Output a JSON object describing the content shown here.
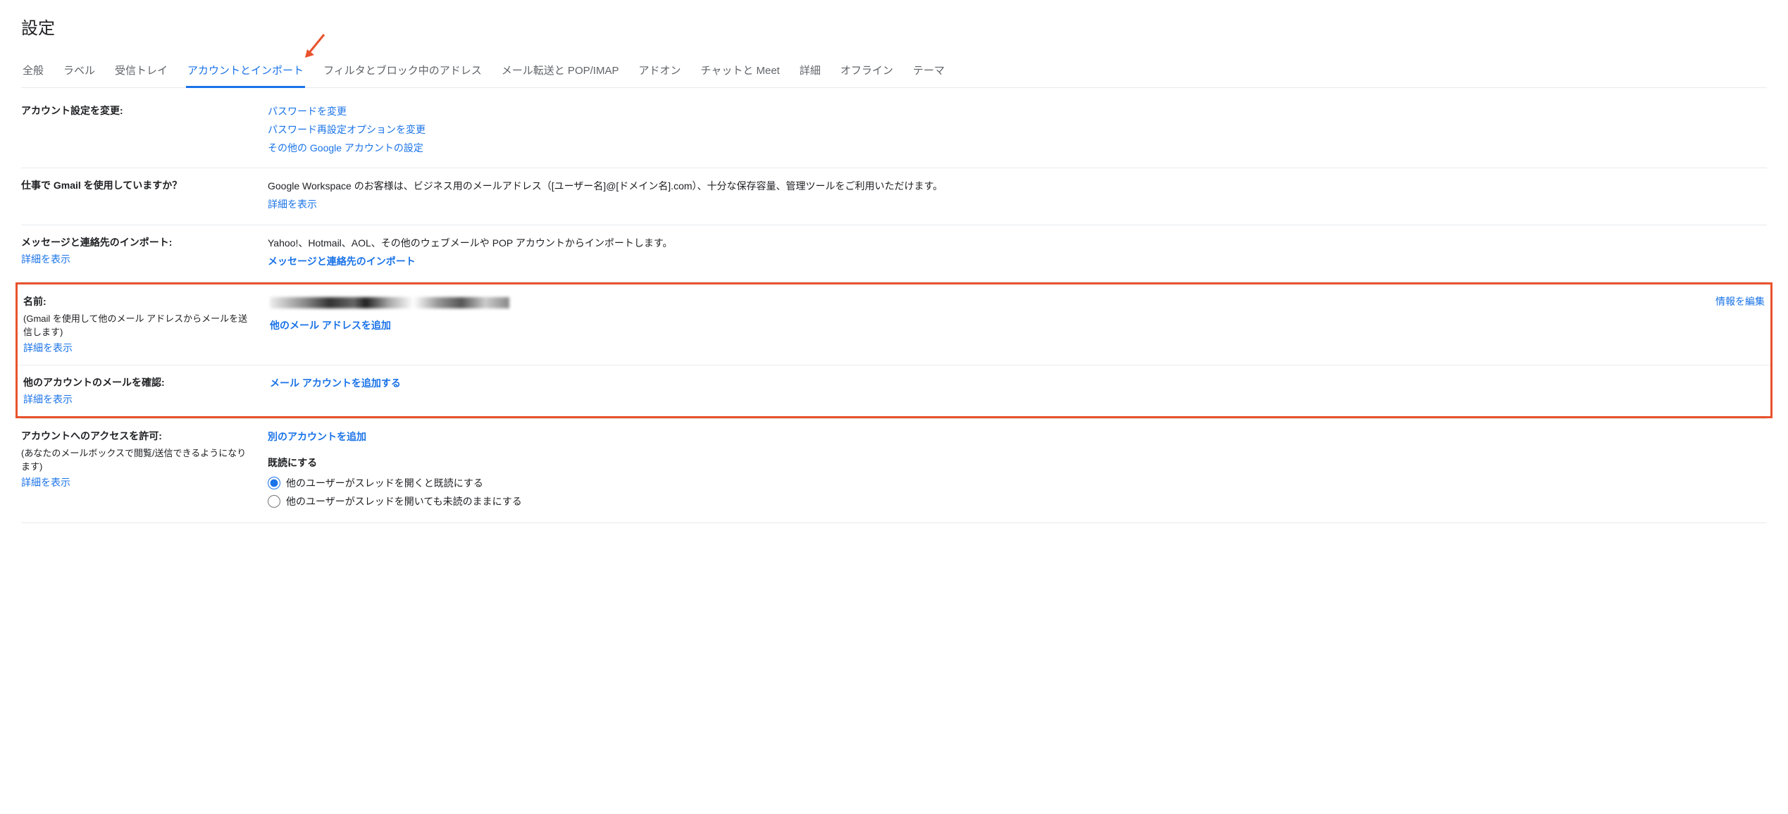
{
  "page_title": "設定",
  "tabs": [
    {
      "label": "全般"
    },
    {
      "label": "ラベル"
    },
    {
      "label": "受信トレイ"
    },
    {
      "label": "アカウントとインポート",
      "active": true
    },
    {
      "label": "フィルタとブロック中のアドレス"
    },
    {
      "label": "メール転送と POP/IMAP"
    },
    {
      "label": "アドオン"
    },
    {
      "label": "チャットと Meet"
    },
    {
      "label": "詳細"
    },
    {
      "label": "オフライン"
    },
    {
      "label": "テーマ"
    }
  ],
  "sections": {
    "account_settings": {
      "title": "アカウント設定を変更:",
      "links": {
        "change_password": "パスワードを変更",
        "change_recovery": "パスワード再設定オプションを変更",
        "other_settings": "その他の Google アカウントの設定"
      }
    },
    "workspace": {
      "title": "仕事で Gmail を使用していますか？",
      "desc": "Google Workspace のお客様は、ビジネス用のメールアドレス（[ユーザー名]@[ドメイン名].com）、十分な保存容量、管理ツールをご利用いただけます。",
      "more": "詳細を表示"
    },
    "import": {
      "title": "メッセージと連絡先のインポート:",
      "more": "詳細を表示",
      "desc": "Yahoo!、Hotmail、AOL、その他のウェブメールや POP アカウントからインポートします。",
      "action": "メッセージと連絡先のインポート"
    },
    "name": {
      "title": "名前:",
      "sub": "(Gmail を使用して他のメール アドレスからメールを送信します)",
      "more": "詳細を表示",
      "add_address": "他のメール アドレスを追加",
      "edit_info": "情報を編集"
    },
    "check_other": {
      "title": "他のアカウントのメールを確認:",
      "more": "詳細を表示",
      "add_account": "メール アカウントを追加する"
    },
    "grant_access": {
      "title": "アカウントへのアクセスを許可:",
      "sub": "(あなたのメールボックスで閲覧/送信できるようになります)",
      "more": "詳細を表示",
      "add_account": "別のアカウントを追加",
      "mark_read_title": "既読にする",
      "option1": "他のユーザーがスレッドを開くと既読にする",
      "option2": "他のユーザーがスレッドを開いても未読のままにする"
    }
  }
}
